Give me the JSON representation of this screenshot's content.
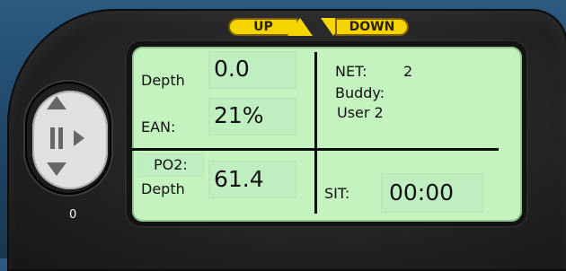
{
  "top": {
    "up": "UP",
    "down": "DOWN"
  },
  "panel": {
    "depth_label": "Depth",
    "depth_value": "0.0",
    "ean_label": "EAN:",
    "ean_value": "21%",
    "po2_label": "PO2:",
    "po2_depth_label": "Depth",
    "po2_value": "61.4",
    "net_label": "NET:",
    "net_value": "2",
    "buddy_label": "Buddy:",
    "buddy_value": "User 2",
    "sit_label": "SIT:",
    "sit_value": "00:00"
  },
  "controls": {
    "counter": "0"
  },
  "icons": {
    "up": "up-triangle-icon",
    "down": "down-triangle-icon",
    "pause": "pause-icon",
    "play": "play-icon"
  },
  "colors": {
    "accent": "#f5d400",
    "lcd": "#c4f3bf"
  }
}
